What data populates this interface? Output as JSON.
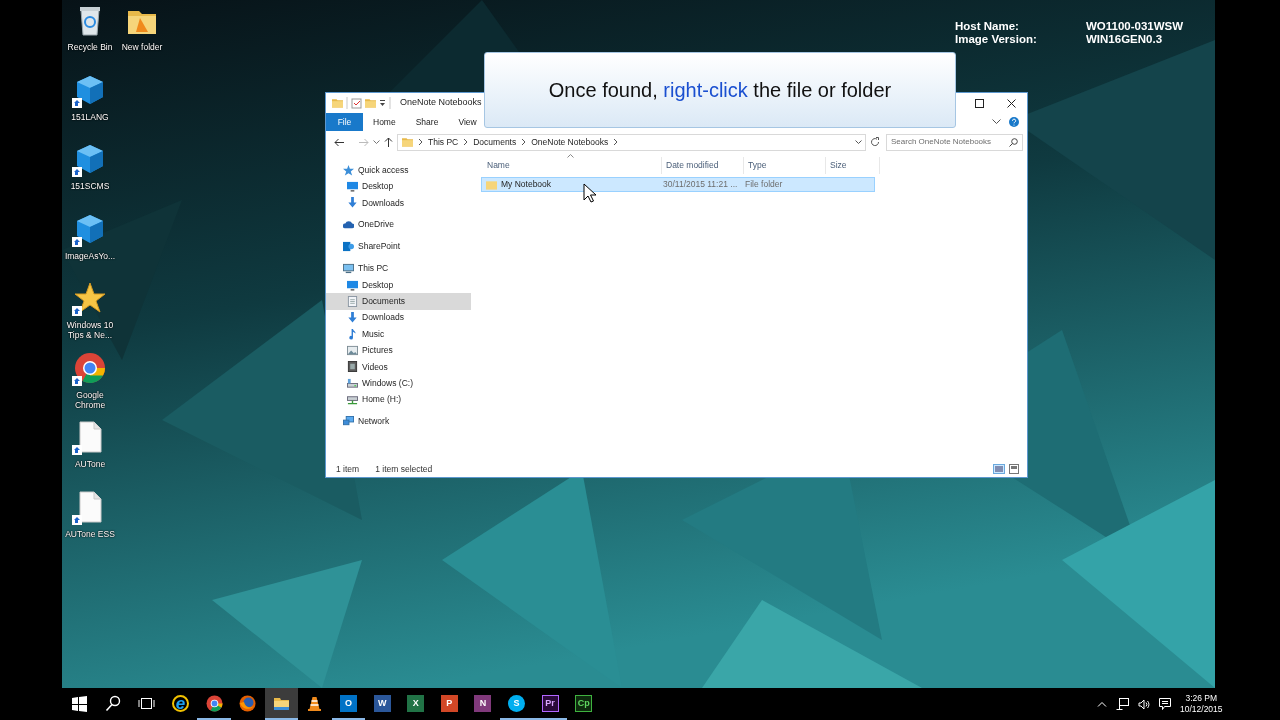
{
  "desktop_info": [
    {
      "label": "Host Name:",
      "value": "WO1100-031WSW"
    },
    {
      "label": "Image Version:",
      "value": "WIN16GEN0.3"
    }
  ],
  "desktop_icons": [
    [
      {
        "label": "Recycle Bin",
        "kind": "recycle",
        "shortcut": false
      },
      {
        "label": "151LANG",
        "kind": "cube",
        "shortcut": true
      },
      {
        "label": "151SCMS",
        "kind": "cube",
        "shortcut": true
      },
      {
        "label": "ImageAsYo...",
        "kind": "cube",
        "shortcut": true
      },
      {
        "label": "Windows 10 Tips & Ne...",
        "kind": "star",
        "shortcut": true
      },
      {
        "label": "Google Chrome",
        "kind": "chrome",
        "shortcut": true
      },
      {
        "label": "AUTone",
        "kind": "document",
        "shortcut": true
      },
      {
        "label": "AUTone ESS",
        "kind": "document",
        "shortcut": true
      }
    ],
    [
      {
        "label": "New folder",
        "kind": "folder",
        "shortcut": false
      }
    ]
  ],
  "callout": {
    "segments": [
      {
        "text": "Once found, ",
        "highlight": false
      },
      {
        "text": "right-click",
        "highlight": true
      },
      {
        "text": " the file or folder",
        "highlight": false
      }
    ]
  },
  "explorer": {
    "title": "OneNote Notebooks",
    "ribbon_tabs": [
      {
        "label": "File",
        "kind": "menu"
      },
      {
        "label": "Home",
        "kind": "tab"
      },
      {
        "label": "Share",
        "kind": "tab"
      },
      {
        "label": "View",
        "kind": "tab"
      }
    ],
    "breadcrumb": [
      "This PC",
      "Documents",
      "OneNote Notebooks"
    ],
    "search": {
      "placeholder": "Search OneNote Notebooks"
    },
    "nav": [
      {
        "label": "Quick access",
        "kind": "star",
        "selected": false,
        "children": [
          {
            "label": "Desktop",
            "kind": "desktop",
            "selected": false
          },
          {
            "label": "Downloads",
            "kind": "download",
            "selected": false
          }
        ]
      },
      {
        "label": "OneDrive",
        "kind": "cloud",
        "selected": false
      },
      {
        "label": "SharePoint",
        "kind": "sharepoint",
        "selected": false
      },
      {
        "label": "This PC",
        "kind": "pc",
        "selected": false,
        "children": [
          {
            "label": "Desktop",
            "kind": "desktop",
            "selected": false
          },
          {
            "label": "Documents",
            "kind": "documents",
            "selected": true
          },
          {
            "label": "Downloads",
            "kind": "download",
            "selected": false
          },
          {
            "label": "Music",
            "kind": "music",
            "selected": false
          },
          {
            "label": "Pictures",
            "kind": "pictures",
            "selected": false
          },
          {
            "label": "Videos",
            "kind": "videos",
            "selected": false
          },
          {
            "label": "Windows (C:)",
            "kind": "drive",
            "selected": false
          },
          {
            "label": "Home (H:)",
            "kind": "netdrive",
            "selected": false
          }
        ]
      },
      {
        "label": "Network",
        "kind": "network",
        "selected": false
      }
    ],
    "columns": [
      "Name",
      "Date modified",
      "Type",
      "Size"
    ],
    "rows": [
      {
        "name": "My Notebook",
        "date": "30/11/2015 11:21 ...",
        "type": "File folder",
        "selected": true
      }
    ],
    "status": [
      "1 item",
      "1 item selected"
    ]
  },
  "taskbar": {
    "apps": [
      {
        "kind": "start",
        "running": false,
        "active": false
      },
      {
        "kind": "search",
        "running": false,
        "active": false
      },
      {
        "kind": "taskview",
        "running": false,
        "active": false
      },
      {
        "kind": "ie",
        "glyph": "e",
        "running": false,
        "active": false
      },
      {
        "kind": "chrome",
        "running": true,
        "active": false
      },
      {
        "kind": "firefox",
        "running": false,
        "active": false
      },
      {
        "kind": "explorer",
        "running": true,
        "active": true
      },
      {
        "kind": "vlc",
        "running": false,
        "active": false
      },
      {
        "kind": "outlook",
        "glyph": "O",
        "running": true,
        "active": false
      },
      {
        "kind": "word",
        "glyph": "W",
        "running": false,
        "active": false
      },
      {
        "kind": "excel",
        "glyph": "X",
        "running": false,
        "active": false
      },
      {
        "kind": "powerpoint",
        "glyph": "P",
        "running": false,
        "active": false
      },
      {
        "kind": "onenote",
        "glyph": "N",
        "running": false,
        "active": false
      },
      {
        "kind": "skype",
        "glyph": "S",
        "running": true,
        "active": false
      },
      {
        "kind": "premiere",
        "glyph": "Pr",
        "running": true,
        "active": false
      },
      {
        "kind": "captivate",
        "glyph": "Cp",
        "running": false,
        "active": false
      }
    ],
    "tray": {
      "time": "3:26 PM",
      "date": "10/12/2015"
    }
  }
}
